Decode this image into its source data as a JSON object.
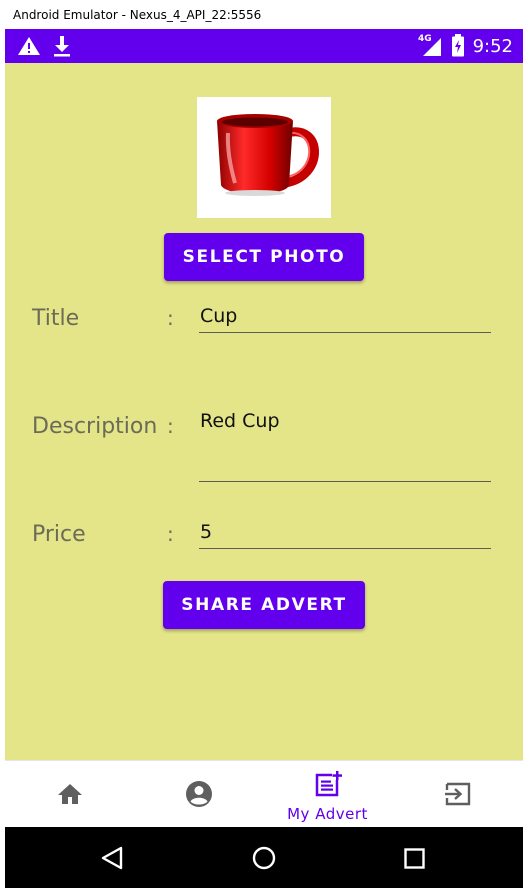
{
  "window": {
    "title": "Android Emulator - Nexus_4_API_22:5556"
  },
  "status_bar": {
    "time": "9:52",
    "network_type": "4G",
    "icons": [
      "warning-icon",
      "download-icon",
      "signal-icon",
      "battery-icon"
    ],
    "background": "#6200ee"
  },
  "form": {
    "background": "#e4e488",
    "select_photo_label": "SELECT PHOTO",
    "photo_alt": "red cup photo",
    "title_label": "Title",
    "title_value": "Cup",
    "description_label": "Description",
    "description_value": "Red Cup",
    "price_label": "Price",
    "price_value": "5",
    "separator": ":",
    "share_label": "SHARE ADVERT",
    "accent": "#6200ee"
  },
  "bottom_nav": {
    "items": [
      {
        "icon": "home-icon",
        "label": ""
      },
      {
        "icon": "account-icon",
        "label": ""
      },
      {
        "icon": "post-add-icon",
        "label": "My Advert",
        "selected": true
      },
      {
        "icon": "logout-icon",
        "label": ""
      }
    ]
  },
  "system_nav": {
    "icons": [
      "back-icon",
      "home-circle-icon",
      "recents-icon"
    ]
  }
}
